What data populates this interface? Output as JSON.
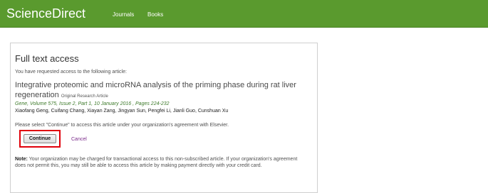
{
  "header": {
    "brand": "ScienceDirect",
    "nav": [
      "Journals",
      "Books"
    ]
  },
  "panel": {
    "title": "Full text access",
    "intro": "You have requested access to the following article:",
    "article": {
      "title": "Integrative proteomic and microRNA analysis of the priming phase during rat liver regeneration",
      "type": "Original Research Article",
      "citation": "Gene, Volume 575, Issue 2, Part 1, 10 January 2016 , Pages 224-232",
      "authors": "Xiaofang Geng, Cuifang Chang, Xiayan Zang, Jingyan Sun, Pengfei Li, Jianli Guo, Cunshuan Xu"
    },
    "select_note": "Please select \"Continue\" to access this article under your organization's agreement with Elsevier.",
    "continue_label": "Continue",
    "cancel_label": "Cancel",
    "note_label": "Note:",
    "note_text": "Your organization may be charged for transactional access to this non-subscribed article. If your organization's agreement does not permit this, you may still be able to access this article by making payment directly with your credit card."
  },
  "colors": {
    "header_bg": "#5a9a2e",
    "highlight": "#e0000a",
    "cancel_link": "#7a2a8a"
  }
}
